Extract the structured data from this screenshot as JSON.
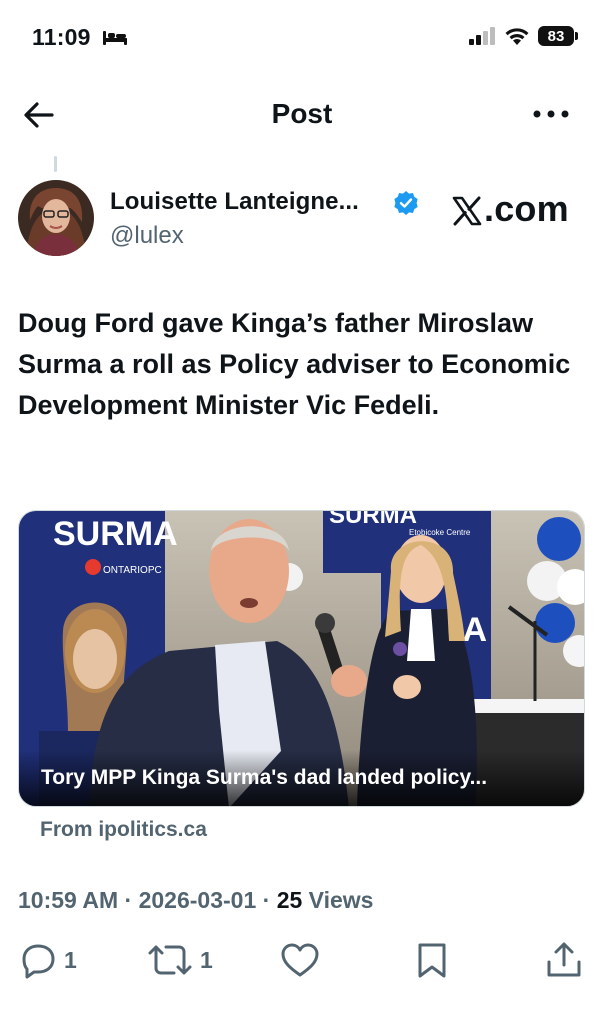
{
  "status_bar": {
    "time": "11:09",
    "battery": "83"
  },
  "nav": {
    "title": "Post"
  },
  "author": {
    "name": "Louisette Lanteigne...",
    "handle": "@lulex",
    "site_label": ".com"
  },
  "post": {
    "text": "Doug Ford gave Kinga’s father Miroslaw Surma a roll as Policy adviser to Economic Development Minister Vic Fedeli."
  },
  "card": {
    "title": "Tory MPP Kinga Surma's dad landed policy...",
    "source": "From ipolitics.ca",
    "banner_left": "SURMA",
    "banner_right": "SURMA",
    "banner_sub": "Etobicoke Centre",
    "party": "ONTARIOPC"
  },
  "meta": {
    "time": "10:59 AM",
    "sep1": " · ",
    "date": "2026-03-01",
    "sep2": " · ",
    "views_count": "25",
    "views_label": " Views"
  },
  "actions": {
    "replies": "1",
    "reposts": "1"
  },
  "colors": {
    "verified": "#1d9bf0",
    "secondary_text": "#536471",
    "primary_text": "#0f1419"
  }
}
